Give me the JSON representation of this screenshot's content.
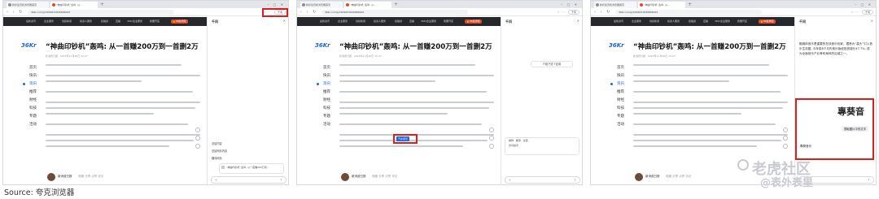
{
  "screens": [
    {
      "tabs": [
        "新标签页和浏览器首页",
        "“神曲印钞机”轰鸣: 从..."
      ],
      "url": "36kr.com/p/3934631840686915",
      "ai_button": "千问",
      "nav": [
        "最新资讯",
        "企业服务",
        "创投新闻",
        "投资人服务",
        "投融资",
        "直播",
        "36Kr企业服务",
        "我要开店",
        "36Kr年度"
      ],
      "hot": "🔥36氪学院",
      "logo": "36Kr",
      "left_nav": [
        "首页",
        "快讯",
        "资讯",
        "推荐",
        "财经",
        "科技",
        "专题",
        "活动"
      ],
      "title": "“神曲印钞机”轰鸣: 从一首赚200万到一首删2万",
      "meta": "新消费日报 · 2025年11月26日 15:27",
      "author": "新消费日报",
      "footer_actions": "收藏  分享  点赞  评论",
      "panel_title": "千问",
      "menu": [
        "总结内容",
        "总结网页内容",
        "翻译网页",
        "提取划线内容",
        "生成网页摘要"
      ],
      "card": "“神曲印钞机”轰鸣: 从一首赚200万到...",
      "chat_placeholder": "问问千问"
    },
    {
      "tabs": [
        "新标签页和浏览器首页",
        "“神曲印钞机”轰鸣: 从..."
      ],
      "url": "36kr.com/p/3934631840686915",
      "ai_button": "千问",
      "nav": [
        "最新资讯",
        "企业服务",
        "创投新闻",
        "投资人服务",
        "投融资",
        "直播",
        "36Kr企业服务",
        "我要开店",
        "36Kr年度"
      ],
      "hot": "🔥36氪学院",
      "logo": "36Kr",
      "left_nav": [
        "首页",
        "快讯",
        "资讯",
        "推荐",
        "财经",
        "科技",
        "专题",
        "活动"
      ],
      "title": "“神曲印钞机”轰鸣: 从一首赚200万到一首删2万",
      "meta": "新消费日报 · 2025年11月26日 15:27",
      "author": "新消费日报",
      "footer_actions": "收藏  分享  点赞  评论",
      "panel_title": "千问",
      "highlight_word": "汽水音乐",
      "bubble": "介绍下这个应用",
      "popup": [
        "解释 · 翻译 · 总结",
        "划词提问"
      ],
      "chat_placeholder": "问问千问"
    },
    {
      "tabs": [
        "新标签页和浏览器首页",
        "“神曲印钞机”轰鸣: 从..."
      ],
      "url": "36kr.com/p/3934631840686915",
      "ai_button": "千问",
      "nav": [
        "最新资讯",
        "企业服务",
        "创投新闻",
        "投资人服务",
        "投融资",
        "直播",
        "36Kr企业服务",
        "我要开店",
        "36Kr年度"
      ],
      "hot": "🔥36氪学院",
      "logo": "36Kr",
      "left_nav": [
        "首页",
        "快讯",
        "资讯",
        "推荐",
        "财经",
        "科技",
        "专题",
        "活动"
      ],
      "title": "“神曲印钞机”轰鸣: 从一首赚200万到一首删2万",
      "meta": "新消费日报 · 2025年11月26日 15:27",
      "author": "新消费日报",
      "footer_actions": "收藏  分享  点赞  评论",
      "panel_title": "千问",
      "panel_text": "融媒体音乐是重要的在线音乐玩家。据悉为“高头”引入音乐生态圈, 今年前8个月内音乐版权投放增长47.7%, 成为全面音乐产业等布局体的后端之一。",
      "zoom_text": "專葵音",
      "zoom_chip": "提取图片中的文字",
      "zoom_label": "專葵音乐"
    }
  ],
  "source": "Source:   夸克浏览器",
  "watermark_1": "老虎社区",
  "watermark_2": "@表外表里"
}
